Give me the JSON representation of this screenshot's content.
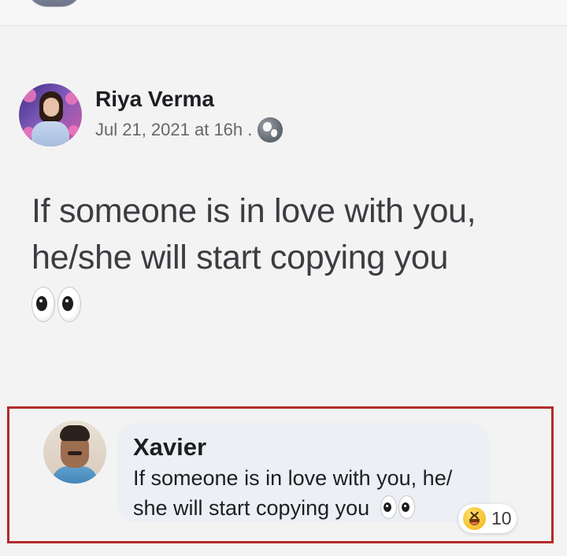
{
  "post": {
    "author": "Riya Verma",
    "timestamp": "Jul 21, 2021 at 16h .",
    "privacy_icon": "globe-icon",
    "text_line_1": "If someone is in love with you,",
    "text_line_2": "he/she will start copying you",
    "emoji": "eyes-emoji"
  },
  "comment": {
    "author": "Xavier",
    "text_line_1": "If someone is in love with you, he/",
    "text_line_2": "she will start copying you",
    "emoji": "eyes-emoji",
    "reaction": {
      "icon": "haha-reaction-icon",
      "count": "10"
    }
  },
  "colors": {
    "highlight_border": "#b32a2a",
    "comment_bubble": "#eceff3",
    "page_background": "#f3f3f3"
  }
}
